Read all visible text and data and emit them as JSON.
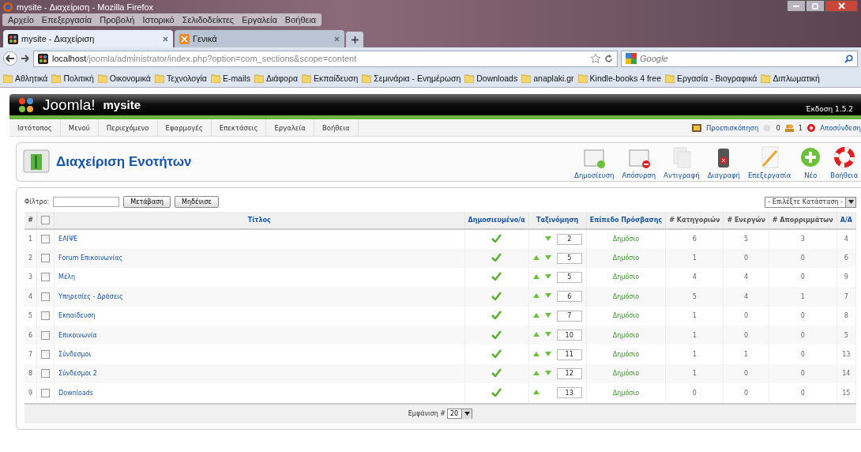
{
  "browser": {
    "title": "mysite - Διαχείριση - Mozilla Firefox",
    "menu": [
      "Αρχείο",
      "Επεξεργασία",
      "Προβολή",
      "Ιστορικό",
      "Σελιδοδείκτες",
      "Εργαλεία",
      "Βοήθεια"
    ],
    "tabs": [
      {
        "label": "mysite - Διαχείριση",
        "selected": true
      },
      {
        "label": "Γενικά",
        "selected": false
      }
    ],
    "url": {
      "host": "localhost",
      "path": "/joomla/administrator/index.php?option=com_sections&scope=content"
    },
    "search": {
      "placeholder": "Google"
    },
    "bookmarks": [
      "Αθλητικά",
      "Πολιτική",
      "Οικονομικά",
      "Τεχνολογία",
      "E-mails",
      "Διάφορα",
      "Εκπαίδευση",
      "Σεμινάρια - Ενημέρωση",
      "Downloads",
      "anaplaki.gr",
      "Kindle-books 4 free",
      "Εργασία - Βιογραφικά",
      "Διπλωματική"
    ]
  },
  "header": {
    "logo_text": "Joomla!",
    "site": "mysite",
    "version": "Έκδοση 1.5.2"
  },
  "admin_menu": [
    "Ιστότοπος",
    "Μενού",
    "Περιεχόμενο",
    "Εφαρμογές",
    "Επεκτάσεις",
    "Εργαλεία",
    "Βοήθεια"
  ],
  "status": {
    "preview": "Προεπισκόπηση",
    "messages": "0",
    "users": "1",
    "logout": "Αποσύνδεση"
  },
  "page_title": "Διαχείριση Ενοτήτων",
  "toolbar": [
    {
      "kind": "publish",
      "label": "Δημοσίευση"
    },
    {
      "kind": "unpublish",
      "label": "Απόσυρση"
    },
    {
      "kind": "copy",
      "label": "Αντιγραφή"
    },
    {
      "kind": "delete",
      "label": "Διαγραφή"
    },
    {
      "kind": "edit",
      "label": "Επεξεργασία"
    },
    {
      "kind": "new",
      "label": "Νέο"
    },
    {
      "kind": "help",
      "label": "Βοήθεια"
    }
  ],
  "filter": {
    "label": "Φίλτρο:",
    "go": "Μετάβαση",
    "reset": "Μηδένισε",
    "state_select": "- Επιλέξτε Κατάσταση -"
  },
  "table": {
    "columns": [
      "#",
      "Τίτλος",
      "Δημοσιευμένο/α",
      "Ταξινόμηση",
      "Επίπεδο Πρόσβασης",
      "# Κατηγοριών",
      "# Ενεργών",
      "# Απορριμμάτων",
      "Α/Α"
    ],
    "all_checked": false,
    "rows": [
      {
        "num": "1",
        "checked": false,
        "title": "ΕΑΙΨΕ",
        "published": true,
        "up": false,
        "down": true,
        "order": "2",
        "access": "Δημόσιο",
        "categories": "6",
        "active": "5",
        "trash": "3",
        "id": "4"
      },
      {
        "num": "2",
        "checked": false,
        "title": "Forum Επικοινωνίας",
        "published": true,
        "up": true,
        "down": true,
        "order": "5",
        "access": "Δημόσιο",
        "categories": "1",
        "active": "0",
        "trash": "0",
        "id": "6"
      },
      {
        "num": "3",
        "checked": false,
        "title": "Μέλη",
        "published": true,
        "up": true,
        "down": true,
        "order": "5",
        "access": "Δημόσιο",
        "categories": "4",
        "active": "4",
        "trash": "0",
        "id": "9"
      },
      {
        "num": "4",
        "checked": false,
        "title": "Υπηρεσίες - Δράσεις",
        "published": true,
        "up": true,
        "down": true,
        "order": "6",
        "access": "Δημόσιο",
        "categories": "5",
        "active": "4",
        "trash": "1",
        "id": "7"
      },
      {
        "num": "5",
        "checked": false,
        "title": "Εκπαίδευση",
        "published": true,
        "up": true,
        "down": true,
        "order": "7",
        "access": "Δημόσιο",
        "categories": "1",
        "active": "0",
        "trash": "0",
        "id": "8"
      },
      {
        "num": "6",
        "checked": false,
        "title": "Επικοινωνία",
        "published": true,
        "up": true,
        "down": true,
        "order": "10",
        "access": "Δημόσιο",
        "categories": "1",
        "active": "0",
        "trash": "0",
        "id": "5"
      },
      {
        "num": "7",
        "checked": false,
        "title": "Σύνδεσμοι",
        "published": true,
        "up": true,
        "down": true,
        "order": "11",
        "access": "Δημόσιο",
        "categories": "1",
        "active": "1",
        "trash": "0",
        "id": "13"
      },
      {
        "num": "8",
        "checked": false,
        "title": "Σύνδεσμοι 2",
        "published": true,
        "up": true,
        "down": true,
        "order": "12",
        "access": "Δημόσιο",
        "categories": "1",
        "active": "0",
        "trash": "0",
        "id": "14"
      },
      {
        "num": "9",
        "checked": false,
        "title": "Downloads",
        "published": true,
        "up": true,
        "down": false,
        "order": "13",
        "access": "Δημόσιο",
        "categories": "0",
        "active": "0",
        "trash": "0",
        "id": "15"
      }
    ],
    "footer": {
      "label": "Εμφάνιση #",
      "limit": "20"
    }
  }
}
